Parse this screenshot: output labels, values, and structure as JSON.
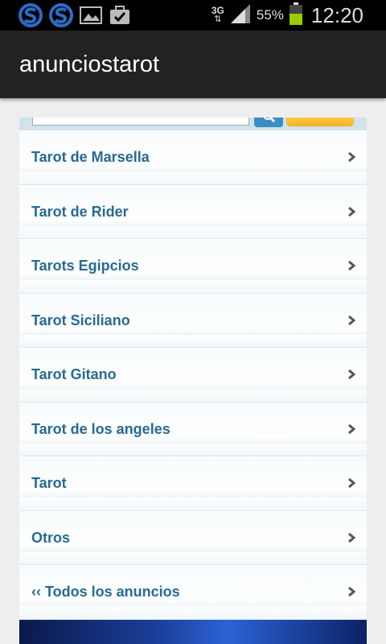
{
  "status_bar": {
    "network_type": "3G",
    "battery_percent": "55%",
    "time": "12:20",
    "icons": [
      "app-s-icon",
      "app-s-icon",
      "image-icon",
      "briefcase-check-icon",
      "data-arrows-icon",
      "signal-icon",
      "battery-icon"
    ],
    "battery_color": "#99cc00"
  },
  "action_bar": {
    "title": "anunciostarot"
  },
  "search": {
    "button_color": "#3a8ec0",
    "accent_button_color": "#f5b020"
  },
  "menu": {
    "items": [
      {
        "label": "Tarot de Marsella"
      },
      {
        "label": "Tarot de Rider"
      },
      {
        "label": "Tarots Egipcios"
      },
      {
        "label": "Tarot Siciliano"
      },
      {
        "label": "Tarot Gitano"
      },
      {
        "label": "Tarot de los angeles"
      },
      {
        "label": "Tarot"
      },
      {
        "label": "Otros"
      },
      {
        "label": "‹‹ Todos los anuncios"
      }
    ],
    "label_color": "#266a92",
    "chevron_icon": "chevron-right-icon"
  }
}
